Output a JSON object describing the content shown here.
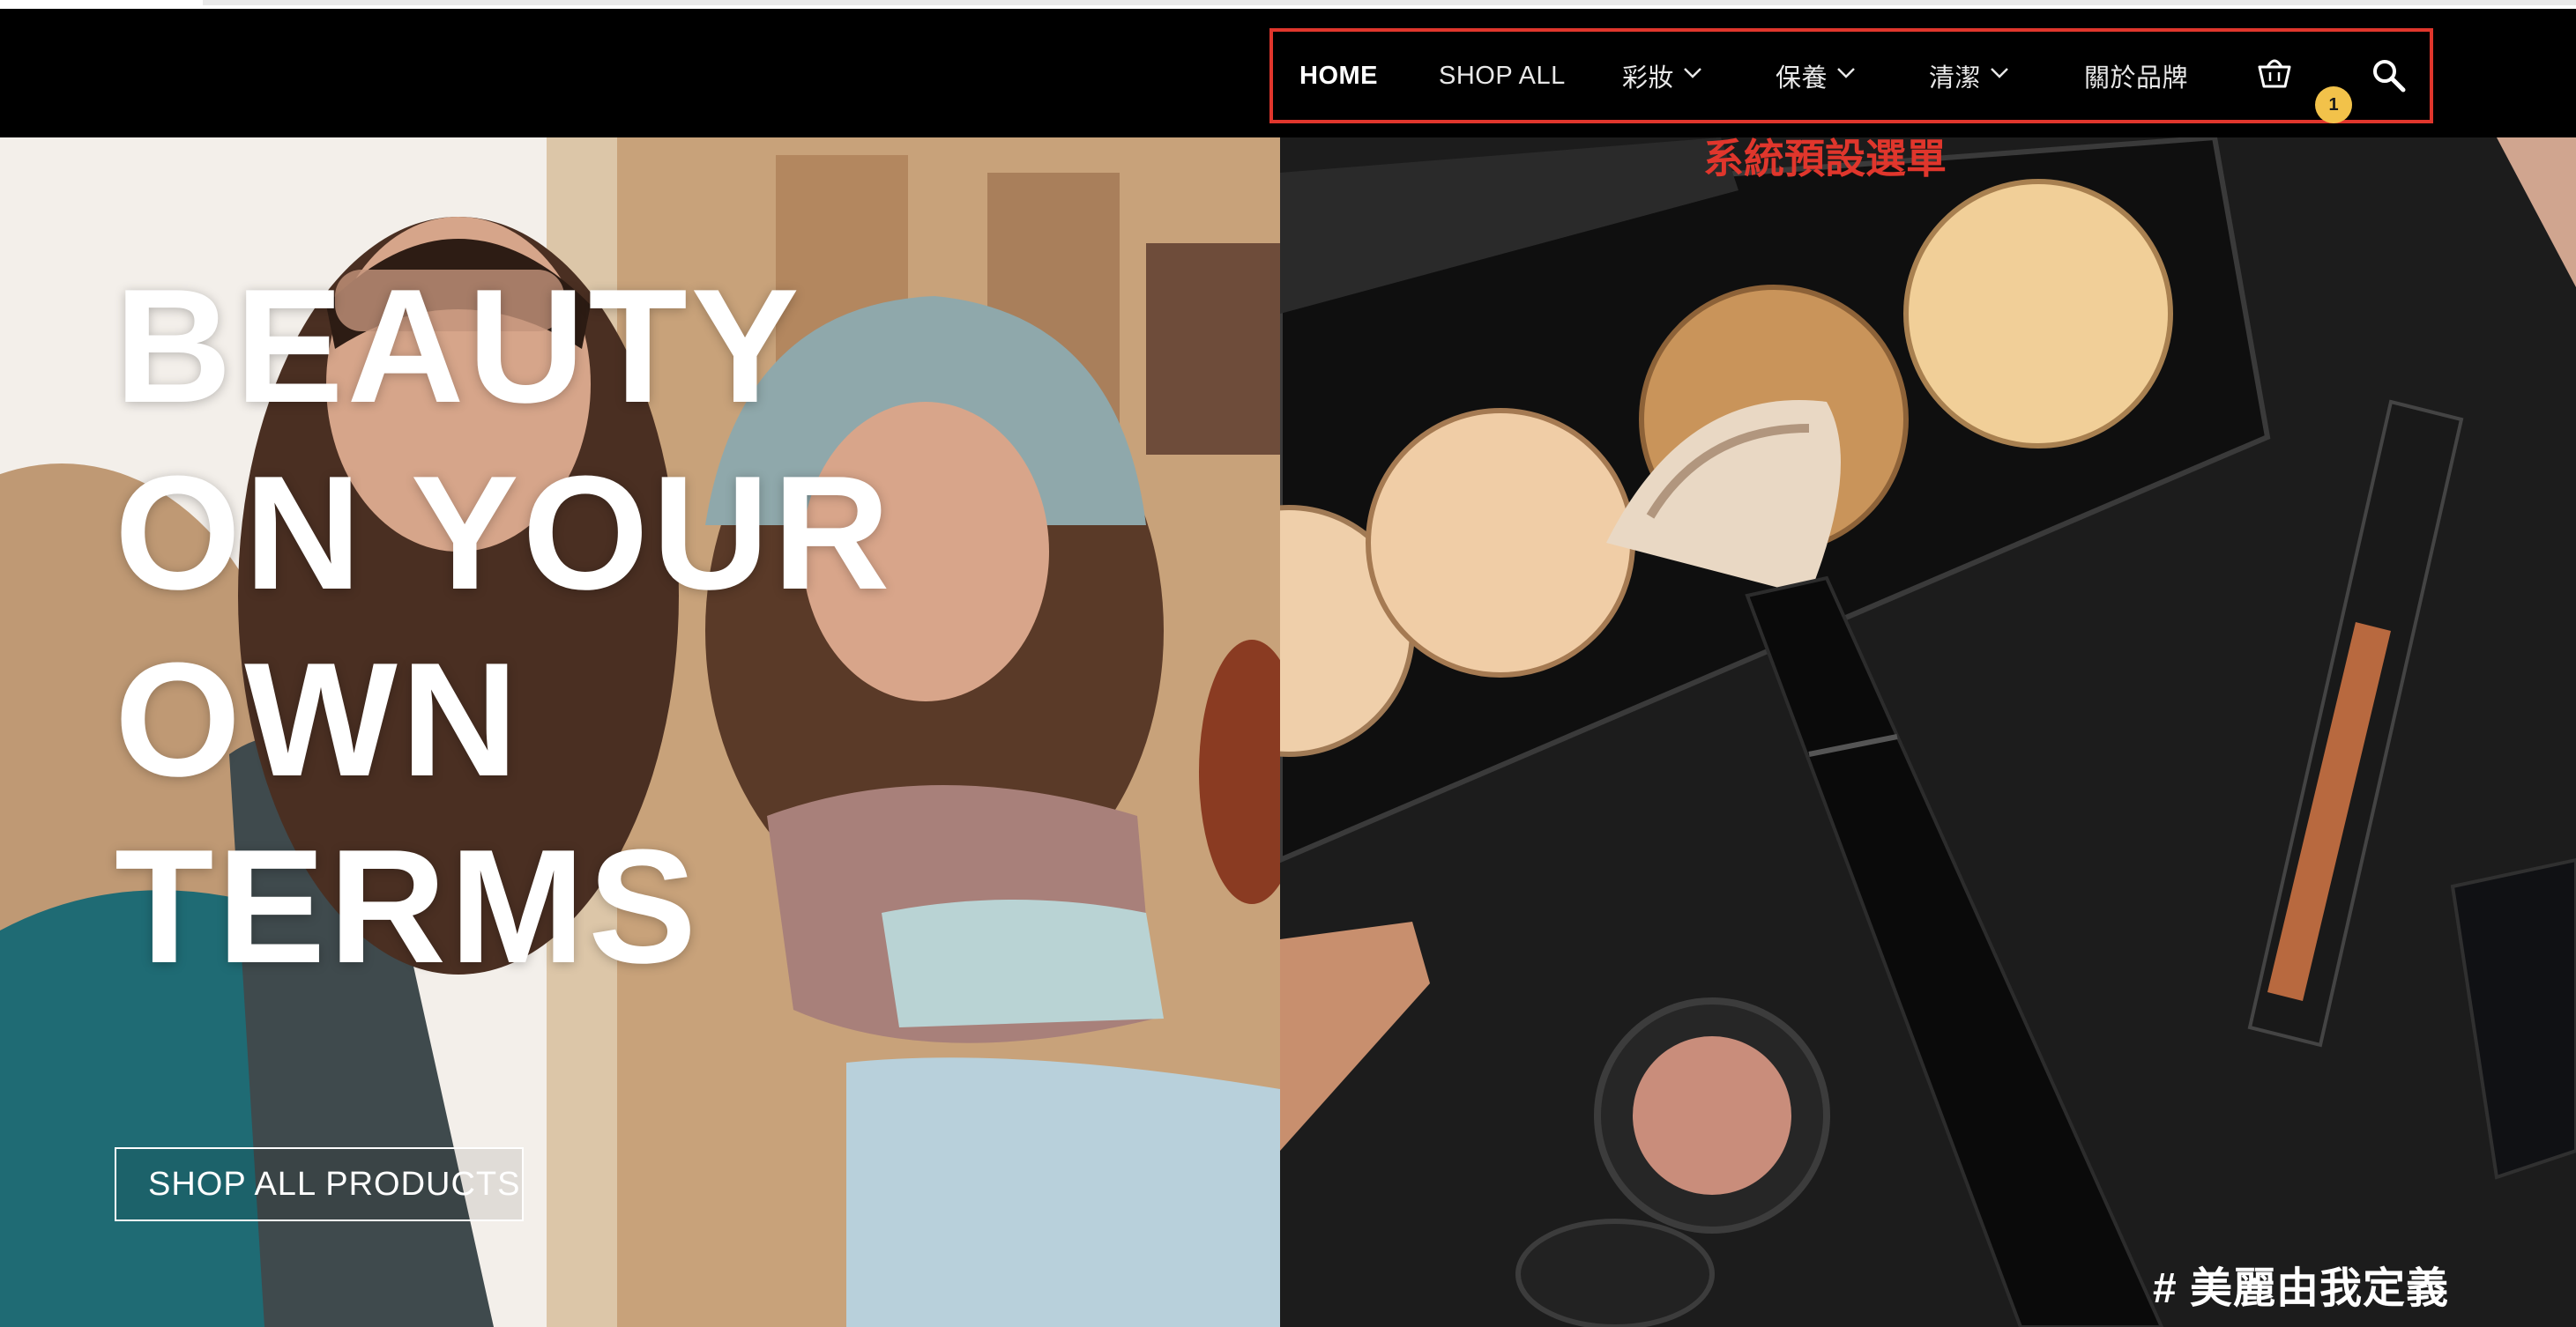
{
  "nav": {
    "items": [
      {
        "label": "HOME",
        "active": true,
        "has_dropdown": false
      },
      {
        "label": "SHOP ALL",
        "active": false,
        "has_dropdown": false
      },
      {
        "label": "彩妝",
        "active": false,
        "has_dropdown": true
      },
      {
        "label": "保養",
        "active": false,
        "has_dropdown": true
      },
      {
        "label": "清潔",
        "active": false,
        "has_dropdown": true
      },
      {
        "label": "關於品牌",
        "active": false,
        "has_dropdown": false
      }
    ],
    "cart_icon": "shopping-basket-icon",
    "cart_count": "1",
    "search_icon": "magnifier-icon"
  },
  "annotation": "系統預設選單",
  "hero": {
    "headline_lines": [
      "BEAUTY",
      "ON YOUR",
      "OWN",
      "TERMS"
    ],
    "cta_label": "SHOP ALL PRODUCTS",
    "tagline": "# 美麗由我定義"
  },
  "colors": {
    "navbar_bg": "#000000",
    "annotation_red": "#e0362c",
    "badge_yellow": "#f2c24a",
    "text_white": "#ffffff"
  }
}
